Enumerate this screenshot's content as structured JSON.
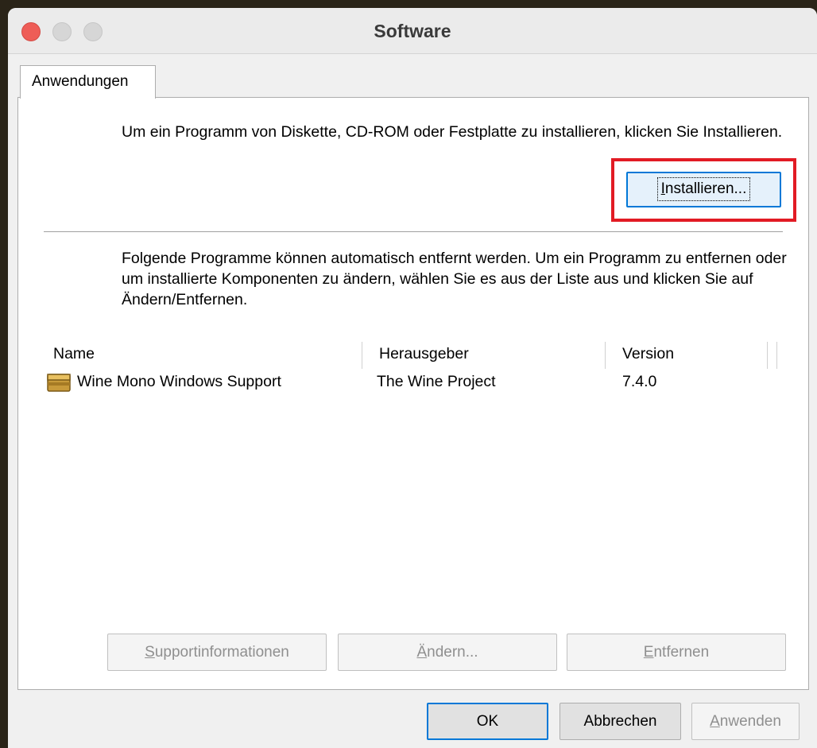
{
  "window": {
    "title": "Software"
  },
  "tabs": [
    {
      "label": "Anwendungen"
    }
  ],
  "install_section": {
    "text": "Um ein Programm von Diskette, CD-ROM oder Festplatte zu installieren, klicken Sie Installieren.",
    "install_button_prefix": "",
    "install_button_access": "I",
    "install_button_rest": "nstallieren..."
  },
  "remove_section": {
    "text": "Folgende Programme können automatisch entfernt werden. Um ein Programm zu entfernen oder um installierte Komponenten zu ändern, wählen Sie es aus der Liste aus und klicken Sie auf Ändern/Entfernen."
  },
  "list": {
    "columns": [
      "Name",
      "Herausgeber",
      "Version"
    ],
    "rows": [
      {
        "name": "Wine Mono Windows Support",
        "publisher": "The Wine Project",
        "version": "7.4.0",
        "icon": "package-icon"
      }
    ]
  },
  "list_buttons": {
    "support_access": "S",
    "support_rest": "upportinformationen",
    "change_access": "Ä",
    "change_rest": "ndern...",
    "remove_access": "E",
    "remove_rest": "ntfernen"
  },
  "dialog_buttons": {
    "ok": "OK",
    "cancel": "Abbrechen",
    "apply_access": "A",
    "apply_rest": "nwenden"
  },
  "colors": {
    "highlight": "#e21b24",
    "focus": "#0078d7"
  }
}
